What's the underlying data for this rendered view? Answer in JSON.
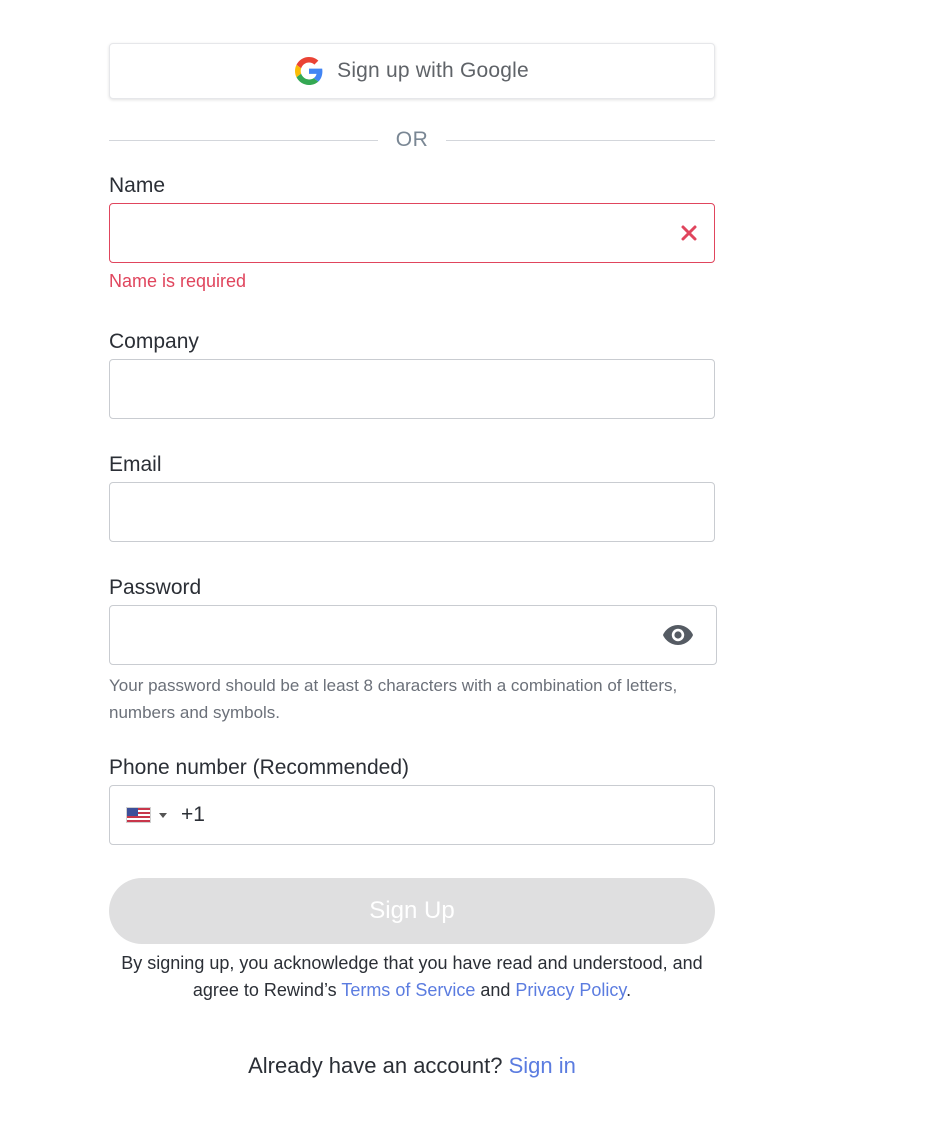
{
  "google_button": {
    "label": "Sign up with Google",
    "icon": "google-g-icon"
  },
  "divider": {
    "text": "OR"
  },
  "fields": {
    "name": {
      "label": "Name",
      "value": "",
      "error": "Name is required"
    },
    "company": {
      "label": "Company",
      "value": ""
    },
    "email": {
      "label": "Email",
      "value": ""
    },
    "password": {
      "label": "Password",
      "value": "",
      "hint": "Your password should be at least 8 characters with a combination of letters, numbers and symbols."
    },
    "phone": {
      "label": "Phone number (Recommended)",
      "country_icon": "us-flag-icon",
      "dial_code": "+1",
      "value": ""
    }
  },
  "submit": {
    "label": "Sign Up",
    "disabled": true
  },
  "legal": {
    "prefix": "By signing up, you acknowledge that you have read and understood, and agree to Rewind’s ",
    "terms_link": "Terms of Service",
    "middle": " and ",
    "privacy_link": "Privacy Policy",
    "suffix": "."
  },
  "signin": {
    "prompt": "Already have an account? ",
    "link": "Sign in"
  },
  "colors": {
    "error": "#e0455d",
    "link": "#5b7ce0",
    "disabled_button": "#dfdfe0"
  }
}
